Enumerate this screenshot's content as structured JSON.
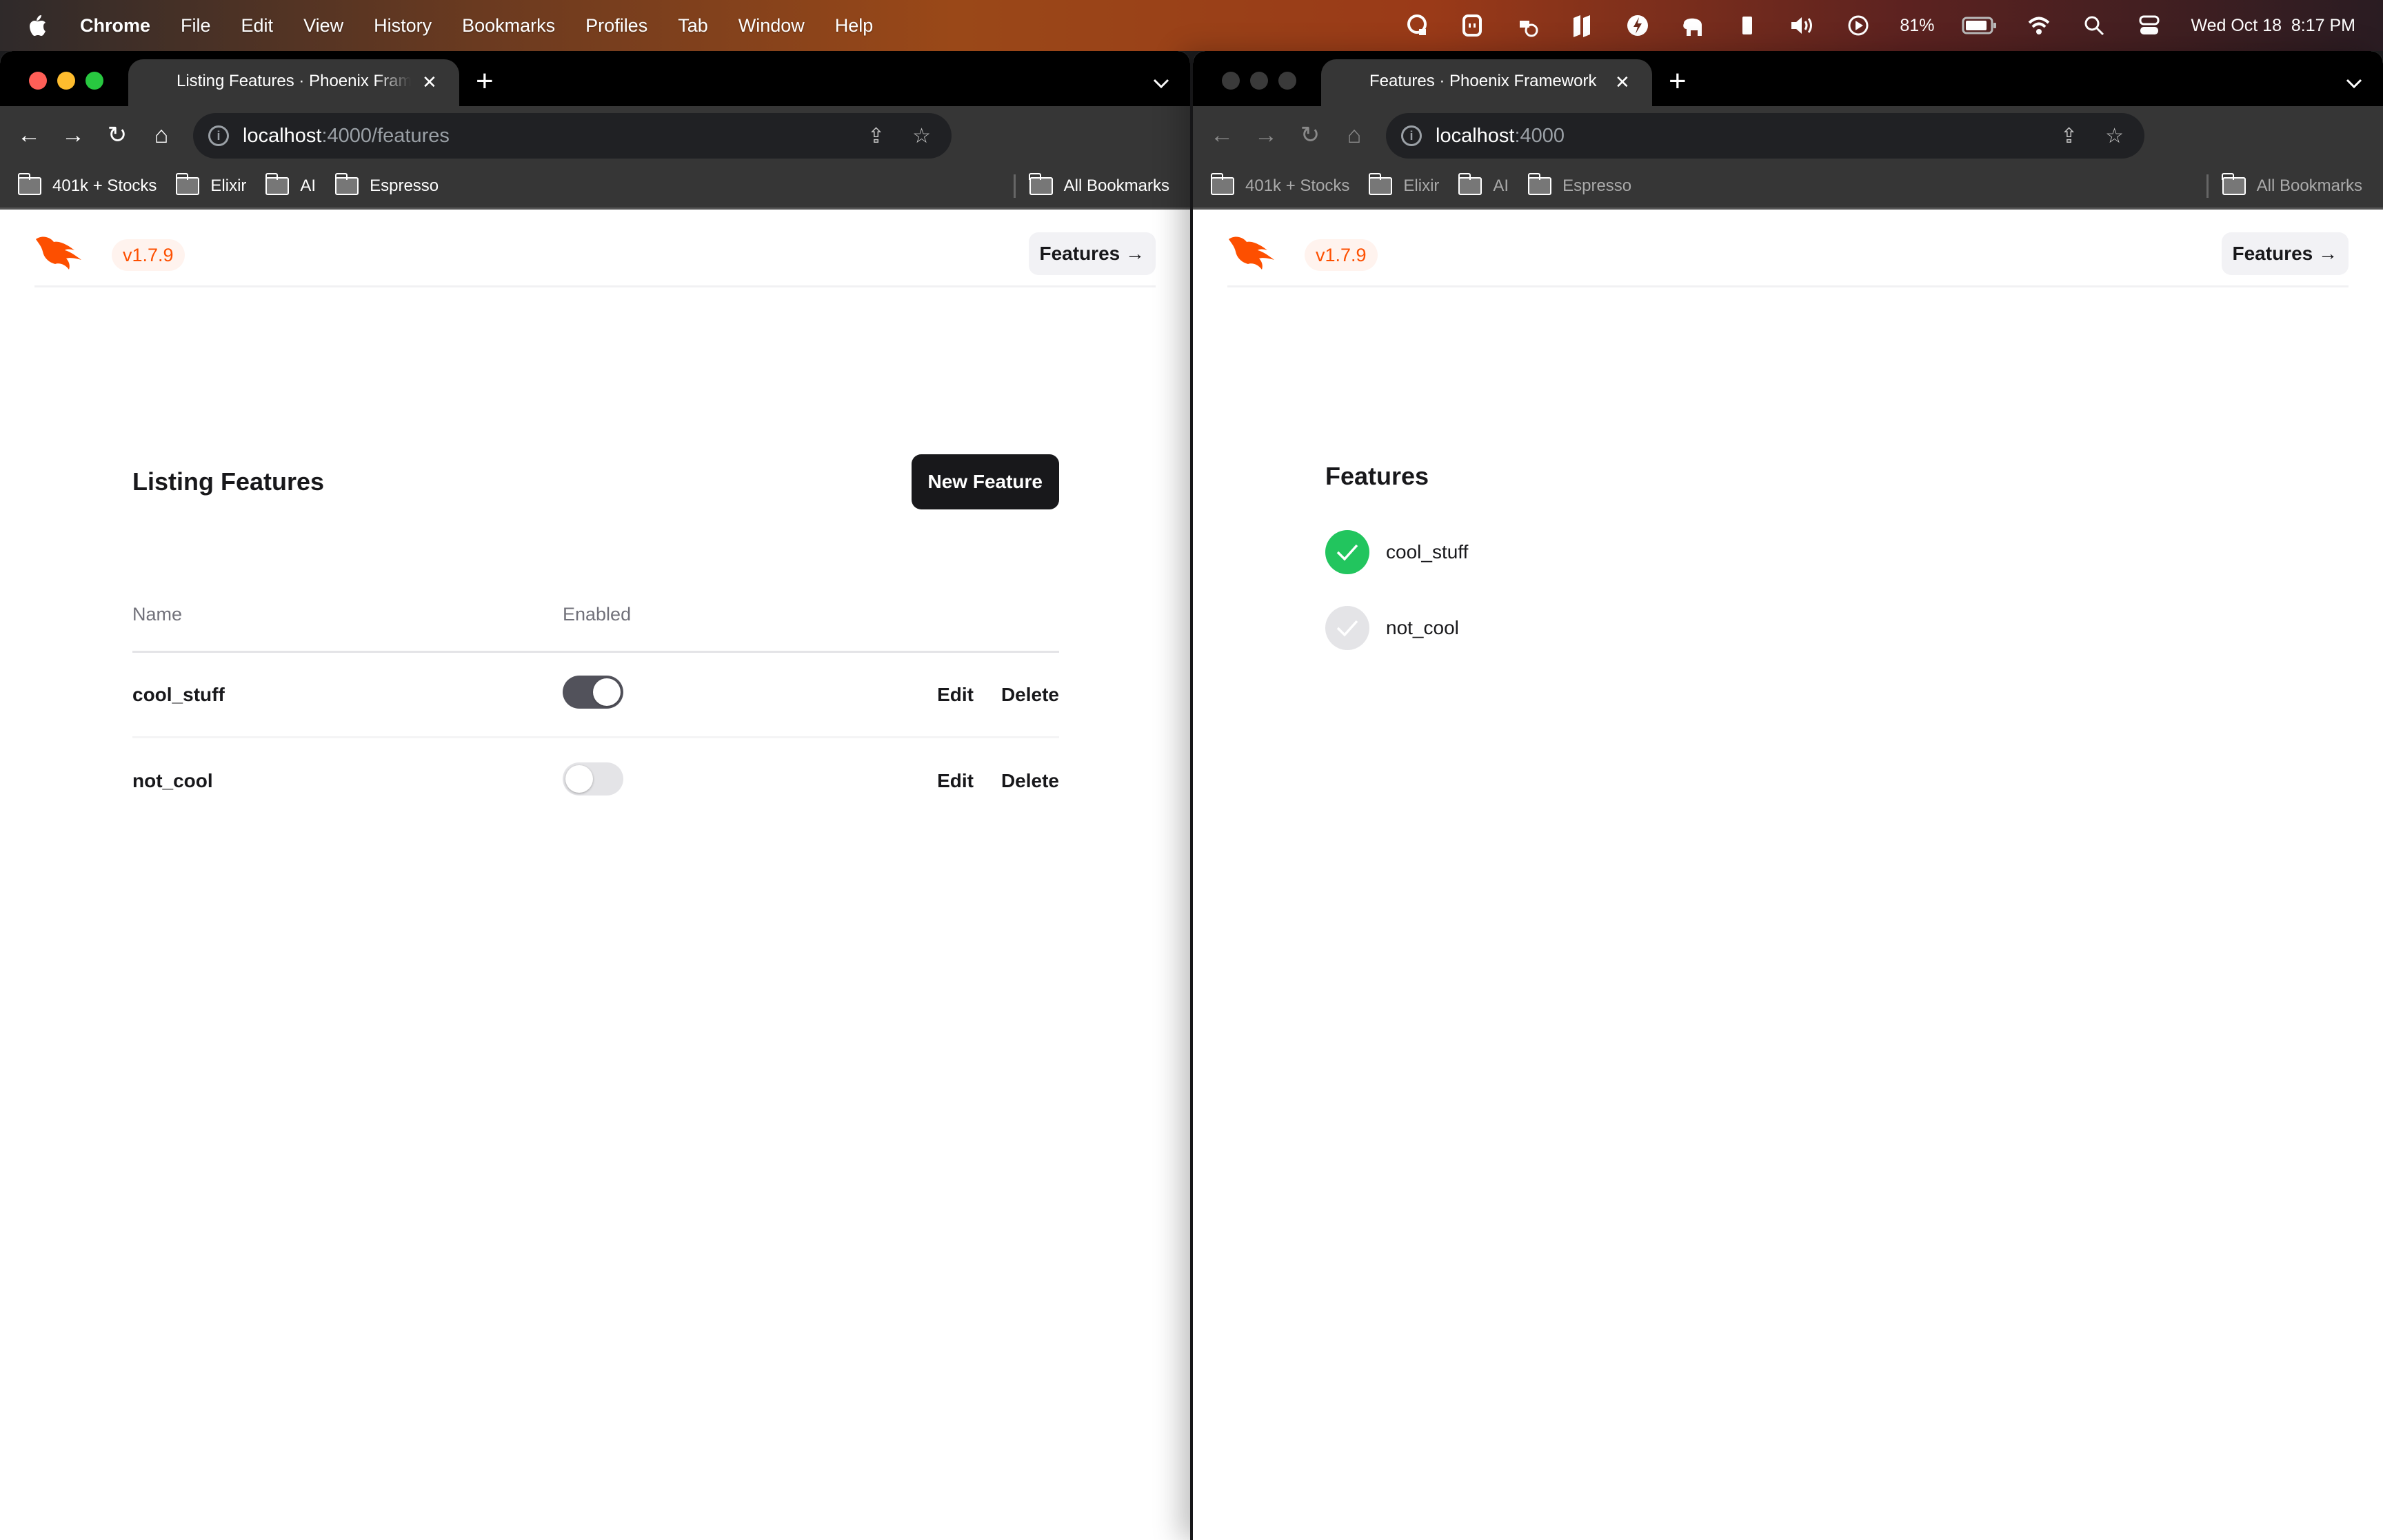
{
  "menubar": {
    "app": "Chrome",
    "items": [
      "File",
      "Edit",
      "View",
      "History",
      "Bookmarks",
      "Profiles",
      "Tab",
      "Window",
      "Help"
    ],
    "battery": "81%",
    "clock": "Wed Oct 18  8:17 PM",
    "status_icons": [
      "1password-icon",
      "menubar-app-icon",
      "docker-icon",
      "parallels-icon",
      "lightning-icon",
      "elephant-icon",
      "keyboard-icon",
      "volume-icon",
      "play-icon",
      "battery-icon",
      "wifi-icon",
      "spotlight-icon",
      "control-center-icon"
    ]
  },
  "bookmarks": [
    "401k + Stocks",
    "Elixir",
    "AI",
    "Espresso"
  ],
  "bookmarks_all": "All Bookmarks",
  "left_window": {
    "tab_title": "Listing Features · Phoenix Framework",
    "url_host": "localhost",
    "url_rest": ":4000/features",
    "header": {
      "version": "v1.7.9",
      "features_link": "Features →"
    },
    "title": "Listing Features",
    "new_button": "New Feature",
    "columns": {
      "name": "Name",
      "enabled": "Enabled"
    },
    "rows": [
      {
        "name": "cool_stuff",
        "enabled": true,
        "edit": "Edit",
        "delete": "Delete"
      },
      {
        "name": "not_cool",
        "enabled": false,
        "edit": "Edit",
        "delete": "Delete"
      }
    ]
  },
  "right_window": {
    "tab_title": "Features · Phoenix Framework",
    "url_host": "localhost",
    "url_rest": ":4000",
    "header": {
      "version": "v1.7.9",
      "features_link": "Features →"
    },
    "title": "Features",
    "items": [
      {
        "name": "cool_stuff",
        "enabled": true
      },
      {
        "name": "not_cool",
        "enabled": false
      }
    ]
  },
  "colors": {
    "phoenix_orange": "#fd4f00",
    "enabled_green": "#22c55e",
    "toggle_on": "#52525b",
    "toggle_off": "#e4e4e7"
  }
}
